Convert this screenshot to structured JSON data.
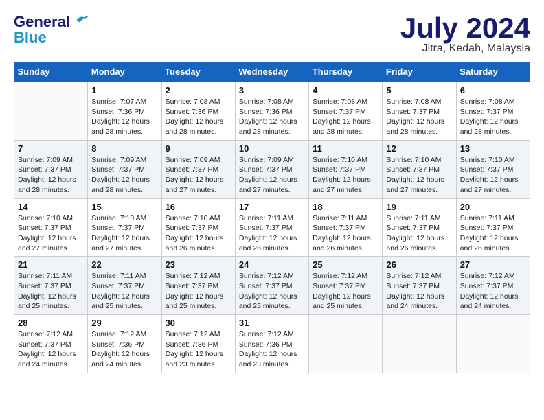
{
  "logo": {
    "line1": "General",
    "line2": "Blue"
  },
  "title": "July 2024",
  "location": "Jitra, Kedah, Malaysia",
  "days_of_week": [
    "Sunday",
    "Monday",
    "Tuesday",
    "Wednesday",
    "Thursday",
    "Friday",
    "Saturday"
  ],
  "weeks": [
    [
      {
        "num": "",
        "sunrise": "",
        "sunset": "",
        "daylight": ""
      },
      {
        "num": "1",
        "sunrise": "Sunrise: 7:07 AM",
        "sunset": "Sunset: 7:36 PM",
        "daylight": "Daylight: 12 hours and 28 minutes."
      },
      {
        "num": "2",
        "sunrise": "Sunrise: 7:08 AM",
        "sunset": "Sunset: 7:36 PM",
        "daylight": "Daylight: 12 hours and 28 minutes."
      },
      {
        "num": "3",
        "sunrise": "Sunrise: 7:08 AM",
        "sunset": "Sunset: 7:36 PM",
        "daylight": "Daylight: 12 hours and 28 minutes."
      },
      {
        "num": "4",
        "sunrise": "Sunrise: 7:08 AM",
        "sunset": "Sunset: 7:37 PM",
        "daylight": "Daylight: 12 hours and 28 minutes."
      },
      {
        "num": "5",
        "sunrise": "Sunrise: 7:08 AM",
        "sunset": "Sunset: 7:37 PM",
        "daylight": "Daylight: 12 hours and 28 minutes."
      },
      {
        "num": "6",
        "sunrise": "Sunrise: 7:08 AM",
        "sunset": "Sunset: 7:37 PM",
        "daylight": "Daylight: 12 hours and 28 minutes."
      }
    ],
    [
      {
        "num": "7",
        "sunrise": "Sunrise: 7:09 AM",
        "sunset": "Sunset: 7:37 PM",
        "daylight": "Daylight: 12 hours and 28 minutes."
      },
      {
        "num": "8",
        "sunrise": "Sunrise: 7:09 AM",
        "sunset": "Sunset: 7:37 PM",
        "daylight": "Daylight: 12 hours and 28 minutes."
      },
      {
        "num": "9",
        "sunrise": "Sunrise: 7:09 AM",
        "sunset": "Sunset: 7:37 PM",
        "daylight": "Daylight: 12 hours and 27 minutes."
      },
      {
        "num": "10",
        "sunrise": "Sunrise: 7:09 AM",
        "sunset": "Sunset: 7:37 PM",
        "daylight": "Daylight: 12 hours and 27 minutes."
      },
      {
        "num": "11",
        "sunrise": "Sunrise: 7:10 AM",
        "sunset": "Sunset: 7:37 PM",
        "daylight": "Daylight: 12 hours and 27 minutes."
      },
      {
        "num": "12",
        "sunrise": "Sunrise: 7:10 AM",
        "sunset": "Sunset: 7:37 PM",
        "daylight": "Daylight: 12 hours and 27 minutes."
      },
      {
        "num": "13",
        "sunrise": "Sunrise: 7:10 AM",
        "sunset": "Sunset: 7:37 PM",
        "daylight": "Daylight: 12 hours and 27 minutes."
      }
    ],
    [
      {
        "num": "14",
        "sunrise": "Sunrise: 7:10 AM",
        "sunset": "Sunset: 7:37 PM",
        "daylight": "Daylight: 12 hours and 27 minutes."
      },
      {
        "num": "15",
        "sunrise": "Sunrise: 7:10 AM",
        "sunset": "Sunset: 7:37 PM",
        "daylight": "Daylight: 12 hours and 27 minutes."
      },
      {
        "num": "16",
        "sunrise": "Sunrise: 7:10 AM",
        "sunset": "Sunset: 7:37 PM",
        "daylight": "Daylight: 12 hours and 26 minutes."
      },
      {
        "num": "17",
        "sunrise": "Sunrise: 7:11 AM",
        "sunset": "Sunset: 7:37 PM",
        "daylight": "Daylight: 12 hours and 26 minutes."
      },
      {
        "num": "18",
        "sunrise": "Sunrise: 7:11 AM",
        "sunset": "Sunset: 7:37 PM",
        "daylight": "Daylight: 12 hours and 26 minutes."
      },
      {
        "num": "19",
        "sunrise": "Sunrise: 7:11 AM",
        "sunset": "Sunset: 7:37 PM",
        "daylight": "Daylight: 12 hours and 26 minutes."
      },
      {
        "num": "20",
        "sunrise": "Sunrise: 7:11 AM",
        "sunset": "Sunset: 7:37 PM",
        "daylight": "Daylight: 12 hours and 26 minutes."
      }
    ],
    [
      {
        "num": "21",
        "sunrise": "Sunrise: 7:11 AM",
        "sunset": "Sunset: 7:37 PM",
        "daylight": "Daylight: 12 hours and 25 minutes."
      },
      {
        "num": "22",
        "sunrise": "Sunrise: 7:11 AM",
        "sunset": "Sunset: 7:37 PM",
        "daylight": "Daylight: 12 hours and 25 minutes."
      },
      {
        "num": "23",
        "sunrise": "Sunrise: 7:12 AM",
        "sunset": "Sunset: 7:37 PM",
        "daylight": "Daylight: 12 hours and 25 minutes."
      },
      {
        "num": "24",
        "sunrise": "Sunrise: 7:12 AM",
        "sunset": "Sunset: 7:37 PM",
        "daylight": "Daylight: 12 hours and 25 minutes."
      },
      {
        "num": "25",
        "sunrise": "Sunrise: 7:12 AM",
        "sunset": "Sunset: 7:37 PM",
        "daylight": "Daylight: 12 hours and 25 minutes."
      },
      {
        "num": "26",
        "sunrise": "Sunrise: 7:12 AM",
        "sunset": "Sunset: 7:37 PM",
        "daylight": "Daylight: 12 hours and 24 minutes."
      },
      {
        "num": "27",
        "sunrise": "Sunrise: 7:12 AM",
        "sunset": "Sunset: 7:37 PM",
        "daylight": "Daylight: 12 hours and 24 minutes."
      }
    ],
    [
      {
        "num": "28",
        "sunrise": "Sunrise: 7:12 AM",
        "sunset": "Sunset: 7:37 PM",
        "daylight": "Daylight: 12 hours and 24 minutes."
      },
      {
        "num": "29",
        "sunrise": "Sunrise: 7:12 AM",
        "sunset": "Sunset: 7:36 PM",
        "daylight": "Daylight: 12 hours and 24 minutes."
      },
      {
        "num": "30",
        "sunrise": "Sunrise: 7:12 AM",
        "sunset": "Sunset: 7:36 PM",
        "daylight": "Daylight: 12 hours and 23 minutes."
      },
      {
        "num": "31",
        "sunrise": "Sunrise: 7:12 AM",
        "sunset": "Sunset: 7:36 PM",
        "daylight": "Daylight: 12 hours and 23 minutes."
      },
      {
        "num": "",
        "sunrise": "",
        "sunset": "",
        "daylight": ""
      },
      {
        "num": "",
        "sunrise": "",
        "sunset": "",
        "daylight": ""
      },
      {
        "num": "",
        "sunrise": "",
        "sunset": "",
        "daylight": ""
      }
    ]
  ]
}
